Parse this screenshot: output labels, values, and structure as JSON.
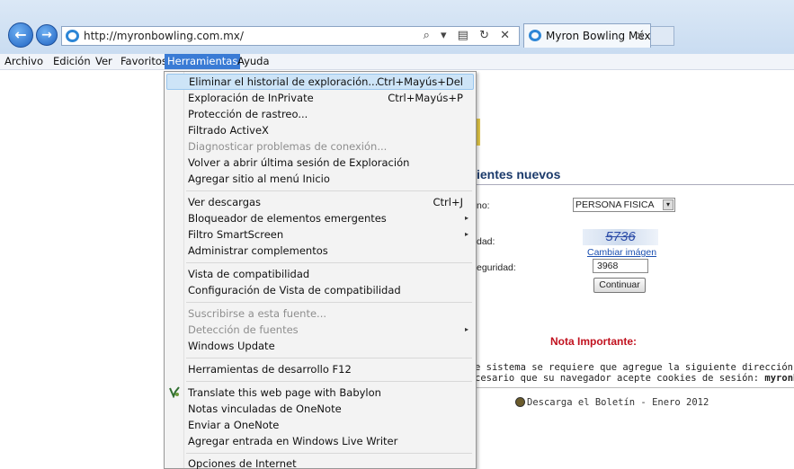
{
  "browser": {
    "url": "http://myronbowling.com.mx/",
    "tab_title": "Myron Bowling Méx...",
    "back_glyph": "←",
    "forward_glyph": "→",
    "address_tools": "⌕ ▾ ▤ ↻ ✕",
    "tab_close": "✕"
  },
  "menubar": {
    "items": [
      "Archivo",
      "Edición",
      "Ver",
      "Favoritos",
      "Herramientas",
      "Ayuda"
    ],
    "active": "Herramientas"
  },
  "tools_menu": {
    "items": [
      {
        "label": "Eliminar el historial de exploración...",
        "shortcut": "Ctrl+Mayús+Del",
        "highlighted": true
      },
      {
        "label": "Exploración de InPrivate",
        "shortcut": "Ctrl+Mayús+P"
      },
      {
        "label": "Protección de rastreo..."
      },
      {
        "label": "Filtrado ActiveX"
      },
      {
        "label": "Diagnosticar problemas de conexión...",
        "disabled": true
      },
      {
        "label": "Volver a abrir última sesión de Exploración"
      },
      {
        "label": "Agregar sitio al menú Inicio"
      },
      {
        "label": "Ver descargas",
        "shortcut": "Ctrl+J"
      },
      {
        "label": "Bloqueador de elementos emergentes",
        "submenu": true
      },
      {
        "label": "Filtro SmartScreen",
        "submenu": true
      },
      {
        "label": "Administrar complementos"
      },
      {
        "label": "Vista de compatibilidad"
      },
      {
        "label": "Configuración de Vista de compatibilidad"
      },
      {
        "label": "Suscribirse a esta fuente...",
        "disabled": true
      },
      {
        "label": "Detección de fuentes",
        "disabled": true,
        "submenu": true
      },
      {
        "label": "Windows Update"
      },
      {
        "label": "Herramientas de desarrollo F12"
      },
      {
        "label": "Translate this web page with Babylon",
        "icon": "babylon-icon"
      },
      {
        "label": "Notas vinculadas de OneNote"
      },
      {
        "label": "Enviar a OneNote"
      },
      {
        "label": "Agregar entrada en Windows Live Writer"
      },
      {
        "label": "Opciones de Internet"
      }
    ],
    "submenu_glyph": "▸"
  },
  "page": {
    "heading": "ientes nuevos",
    "label_tipo": "no:",
    "select_value": "PERSONA FISICA",
    "select_arrow": "▾",
    "label_codigo": "dad:",
    "captcha_text": "5736",
    "captcha_link": "Cambiar imágen",
    "label_seguridad": "eguridad:",
    "security_input": "3968",
    "continue_button": "Continuar",
    "nota_title": "Nota Importante:",
    "nota_line1": "e sistema se requiere que agregue la siguiente dirección a sus sitios de confianza",
    "nota_line2_prefix": "cesario que su navegador acepte cookies de sesión: ",
    "nota_line2_bold": "myronbowling.mx",
    "boletin": "Descarga el Boletín - Enero 2012"
  }
}
